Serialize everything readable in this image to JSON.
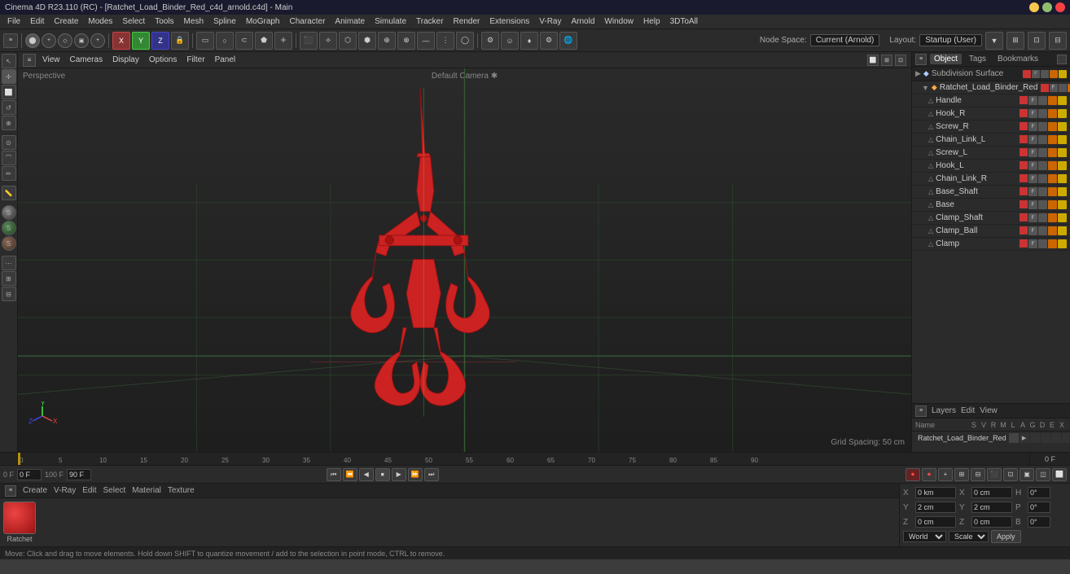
{
  "titleBar": {
    "title": "Cinema 4D R23.110 (RC) - [Ratchet_Load_Binder_Red_c4d_arnold.c4d] - Main"
  },
  "menuBar": {
    "items": [
      "File",
      "Edit",
      "Create",
      "Modes",
      "Select",
      "Tools",
      "Mesh",
      "Spline",
      "MoGraph",
      "Character",
      "Animate",
      "Simulate",
      "Tracker",
      "Render",
      "Extensions",
      "V-Ray",
      "Arnold",
      "Window",
      "Help",
      "3DToAll"
    ]
  },
  "nodeBar": {
    "label": "Node Space:",
    "value": "Current (Arnold)",
    "layout": "Layout:",
    "layoutValue": "Startup (User)"
  },
  "viewportToolbar": {
    "items": [
      "View",
      "Cameras",
      "Display",
      "Options",
      "Filter",
      "Panel"
    ],
    "perspective": "Perspective",
    "camera": "Default Camera ✱",
    "gridSpacing": "Grid Spacing: 50 cm"
  },
  "rightPanel": {
    "tabs": [
      "Object",
      "Tags",
      "Bookmarks"
    ],
    "topItem": "Subdivision Surface",
    "parentItem": "Ratchet_Load_Binder_Red",
    "objects": [
      {
        "name": "Handle",
        "indent": 2
      },
      {
        "name": "Hook_R",
        "indent": 2
      },
      {
        "name": "Screw_R",
        "indent": 2
      },
      {
        "name": "Chain_Link_L",
        "indent": 2
      },
      {
        "name": "Screw_L",
        "indent": 2
      },
      {
        "name": "Hook_L",
        "indent": 2
      },
      {
        "name": "Chain_Link_R",
        "indent": 2
      },
      {
        "name": "Base_Shaft",
        "indent": 2
      },
      {
        "name": "Base",
        "indent": 2
      },
      {
        "name": "Clamp_Shaft",
        "indent": 2
      },
      {
        "name": "Clamp_Ball",
        "indent": 2
      },
      {
        "name": "Clamp",
        "indent": 2
      }
    ]
  },
  "layersPanel": {
    "menuItems": [
      "Layers",
      "Edit",
      "View"
    ],
    "columns": {
      "name": "Name",
      "s": "S",
      "v": "V",
      "r": "R",
      "m": "M",
      "l": "L",
      "a": "A",
      "g": "G",
      "d": "D",
      "e": "E",
      "x": "X"
    },
    "layer": "Ratchet_Load_Binder_Red"
  },
  "timeline": {
    "ticks": [
      "0",
      "5",
      "10",
      "15",
      "20",
      "25",
      "30",
      "35",
      "40",
      "45",
      "50",
      "55",
      "60",
      "65",
      "70",
      "75",
      "80",
      "85",
      "90"
    ],
    "currentFrame": "0 F",
    "startFrame": "0 F",
    "endFrameLeft": "100 F",
    "endFrameRight": "90 F"
  },
  "playback": {
    "fps_label": "90 F",
    "fps_label2": "90 F",
    "frame_input": "0 F"
  },
  "materialPanel": {
    "menuItems": [
      "Create",
      "V-Ray",
      "Edit",
      "Select",
      "Material",
      "Texture"
    ],
    "material": {
      "name": "Ratchet",
      "color": "#cc3333"
    }
  },
  "coordinatesPanel": {
    "position": {
      "x": "0 cm",
      "y": "2 cm",
      "z": "0 cm"
    },
    "size": {
      "x": "0 cm",
      "y": "2 cm",
      "z": "0 cm"
    },
    "rotation": {
      "h": "0°",
      "p": "0°",
      "b": "0°"
    },
    "mode": "World",
    "scaleMode": "Scale",
    "applyLabel": "Apply"
  },
  "statusBar": {
    "text": "Move: Click and drag to move elements. Hold down SHIFT to quantize movement / add to the selection in point mode, CTRL to remove."
  },
  "icons": {
    "undo": "↩",
    "redo": "↪",
    "play": "▶",
    "pause": "⏸",
    "stop": "⏹",
    "rewind": "⏮",
    "forward": "⏭",
    "stepBack": "⏪",
    "stepForward": "⏩",
    "record": "⏺",
    "triangle": "▲",
    "object": "◆",
    "tag": "⬛",
    "chevronRight": "▶",
    "collapse": "▼"
  }
}
